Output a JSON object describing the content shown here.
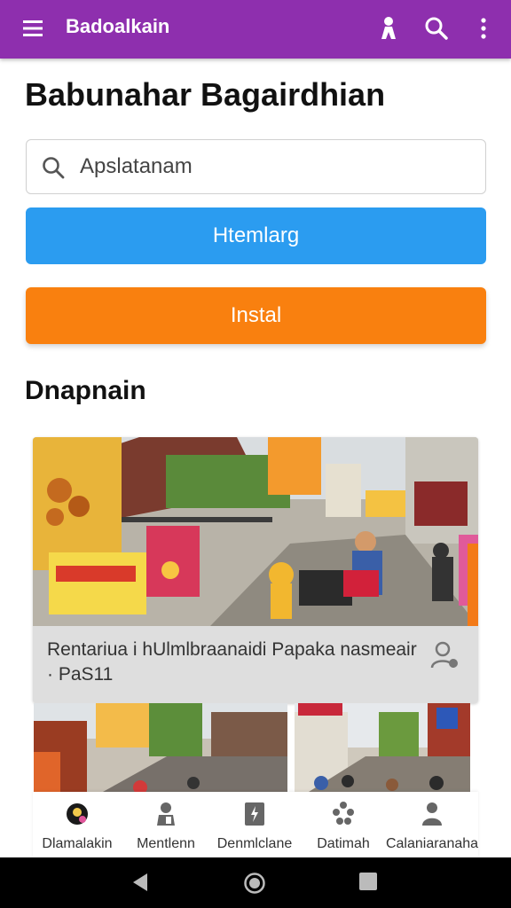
{
  "appbar": {
    "title": "Badoalkain",
    "background": "#8e2fae",
    "icons": [
      "menu-icon",
      "person-icon",
      "search-icon",
      "more-vert-icon"
    ]
  },
  "page_title": "Babunahar Bagairdhian",
  "search": {
    "placeholder": "Apslatanam",
    "value": ""
  },
  "buttons": {
    "primary_label": "Htemlarg",
    "primary_color": "#2b9cf0",
    "secondary_label": "Instal",
    "secondary_color": "#f9800f"
  },
  "section_title": "Dnapnain",
  "featured": {
    "caption": "Rentariua i hUlmlbraanaidi Papaka nasmeair · PaS11",
    "icons": [
      "street-market-photo",
      "share-person-icon"
    ]
  },
  "bottom_nav": {
    "items": [
      {
        "label": "Dlamalakin",
        "icon": "home-icon"
      },
      {
        "label": "Mentlenn",
        "icon": "user-icon"
      },
      {
        "label": "Denmlclane",
        "icon": "download-icon"
      },
      {
        "label": "Datimah",
        "icon": "group-icon"
      },
      {
        "label": "Calaniaranaha",
        "icon": "account-icon"
      }
    ]
  },
  "system_nav": [
    "back-icon",
    "home-circle-icon",
    "recents-icon"
  ]
}
